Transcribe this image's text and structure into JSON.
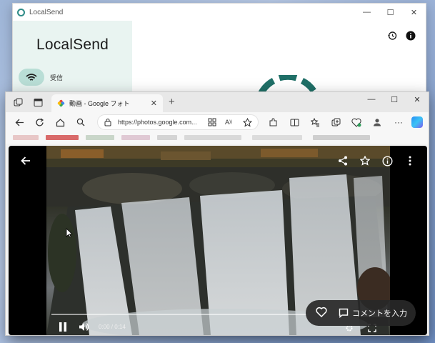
{
  "localsend": {
    "window_title": "LocalSend",
    "brand": "LocalSend",
    "receive_label": "受信",
    "accent": "#2e8b87"
  },
  "edge": {
    "tab_title": "動画 - Google フォト",
    "address": "https://photos.google.com...",
    "colors": {
      "tab_bg": "#f7f7f7",
      "tabbar_bg": "#e8e8e8"
    }
  },
  "player": {
    "time": "0:00 / 0:14",
    "progress": 0.0,
    "comment_label": "コメントを入力"
  },
  "icons": [
    "back-arrow-icon",
    "share-icon",
    "star-icon",
    "info-icon",
    "more-vert-icon",
    "pause-icon",
    "volume-icon",
    "heart-icon",
    "comment-icon",
    "settings-icon",
    "fullscreen-icon",
    "history-icon",
    "wifi-icon",
    "refresh-icon",
    "home-icon",
    "search-icon",
    "lock-icon",
    "favorites-icon",
    "extensions-icon",
    "copilot-icon"
  ]
}
